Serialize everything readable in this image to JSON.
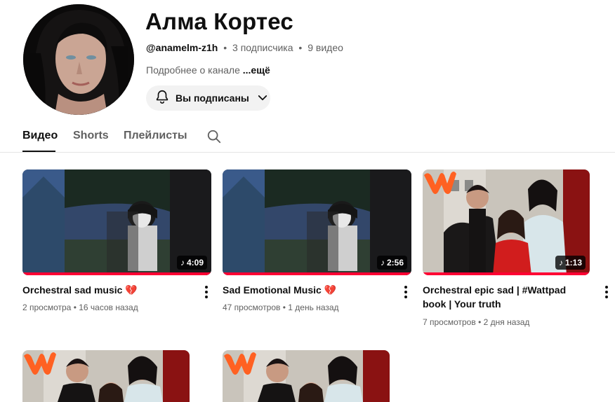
{
  "channel": {
    "name": "Алма Кортес",
    "handle": "@anamelm-z1h",
    "subscribers": "3 подписчика",
    "videos_count": "9 видео",
    "sep": "•",
    "about": "Подробнее о канале",
    "more": "...ещё",
    "subscribe_label": "Вы подписаны"
  },
  "tabs": [
    {
      "label": "Видео",
      "active": true
    },
    {
      "label": "Shorts",
      "active": false
    },
    {
      "label": "Плейлисты",
      "active": false
    }
  ],
  "videos": [
    {
      "title": "Orchestral sad music",
      "emoji": "💔",
      "views": "2 просмотра",
      "age": "16 часов назад",
      "duration": "4:09",
      "progress": 1.0,
      "thumb": "anime-forest"
    },
    {
      "title": "Sad Emotional Music",
      "emoji": "💔",
      "views": "47 просмотров",
      "age": "1 день назад",
      "duration": "2:56",
      "progress": 1.0,
      "thumb": "anime-forest"
    },
    {
      "title": "Orchestral epic sad | #Wattpad book | Your truth",
      "emoji": "",
      "views": "7 просмотров",
      "age": "2 дня назад",
      "duration": "1:13",
      "progress": 1.0,
      "thumb": "wattpad-couple"
    },
    {
      "title": "",
      "thumb": "wattpad-couple"
    },
    {
      "title": "",
      "thumb": "wattpad-couple"
    }
  ],
  "icons": {
    "bell": "bell-icon",
    "chevron": "chevron-down-icon",
    "search": "search-icon",
    "music": "music-note-icon",
    "more": "more-vert-icon"
  },
  "colors": {
    "accent_red": "#ff0033",
    "wattpad_orange": "#ff6122",
    "text_secondary": "#606060"
  }
}
